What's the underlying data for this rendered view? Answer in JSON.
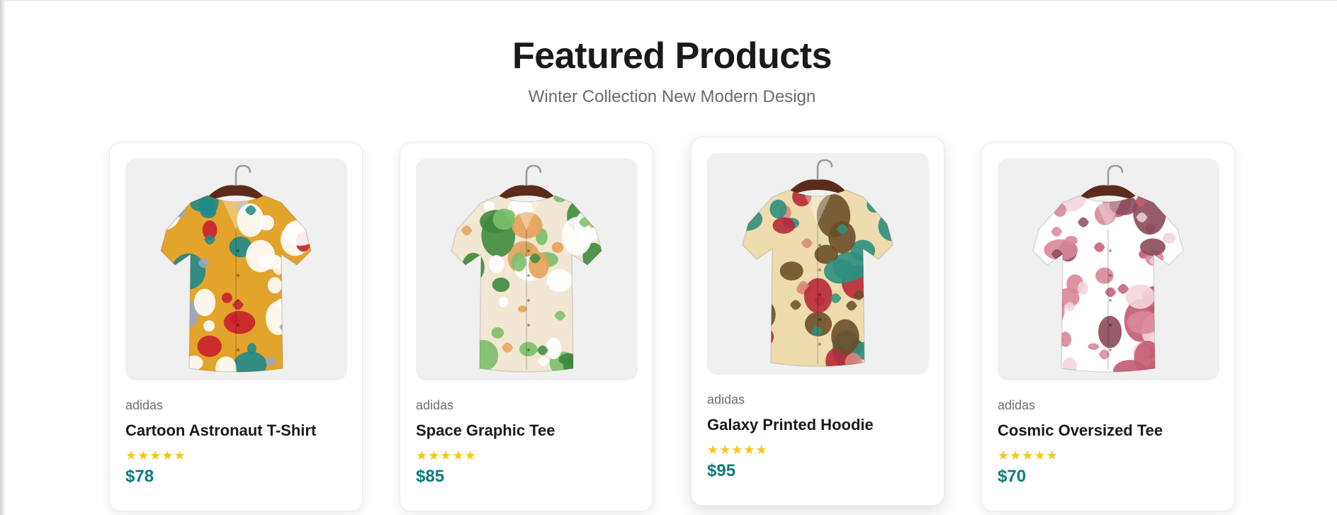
{
  "section": {
    "title": "Featured Products",
    "subtitle": "Winter Collection New Modern Design"
  },
  "products": [
    {
      "brand": "adidas",
      "name": "Cartoon Astronaut T-Shirt",
      "rating": 5,
      "rating_stars": "★★★★★",
      "price": "$78",
      "image_icon": "shirt-image",
      "colors": [
        "#e3a42b",
        "#1f8a8a",
        "#9aa7c7",
        "#ffffff",
        "#c8202e"
      ]
    },
    {
      "brand": "adidas",
      "name": "Space Graphic Tee",
      "rating": 5,
      "rating_stars": "★★★★★",
      "price": "$85",
      "image_icon": "shirt-image",
      "colors": [
        "#f2e7d3",
        "#3d8a3d",
        "#7bbf6a",
        "#ffffff",
        "#e6a15a"
      ]
    },
    {
      "brand": "adidas",
      "name": "Galaxy Printed Hoodie",
      "rating": 5,
      "rating_stars": "★★★★★",
      "price": "$95",
      "image_icon": "shirt-image",
      "colors": [
        "#efdcae",
        "#b8293a",
        "#2e8f7e",
        "#d78a7a",
        "#6a4f2a"
      ]
    },
    {
      "brand": "adidas",
      "name": "Cosmic Oversized Tee",
      "rating": 5,
      "rating_stars": "★★★★★",
      "price": "$70",
      "image_icon": "shirt-image",
      "colors": [
        "#ffffff",
        "#d9879a",
        "#c45a72",
        "#f3d6dc",
        "#8c4a5a"
      ]
    }
  ],
  "theme": {
    "price_color": "#0b7c7e",
    "star_color": "#f5c518",
    "image_bg": "#f0f0f0"
  }
}
